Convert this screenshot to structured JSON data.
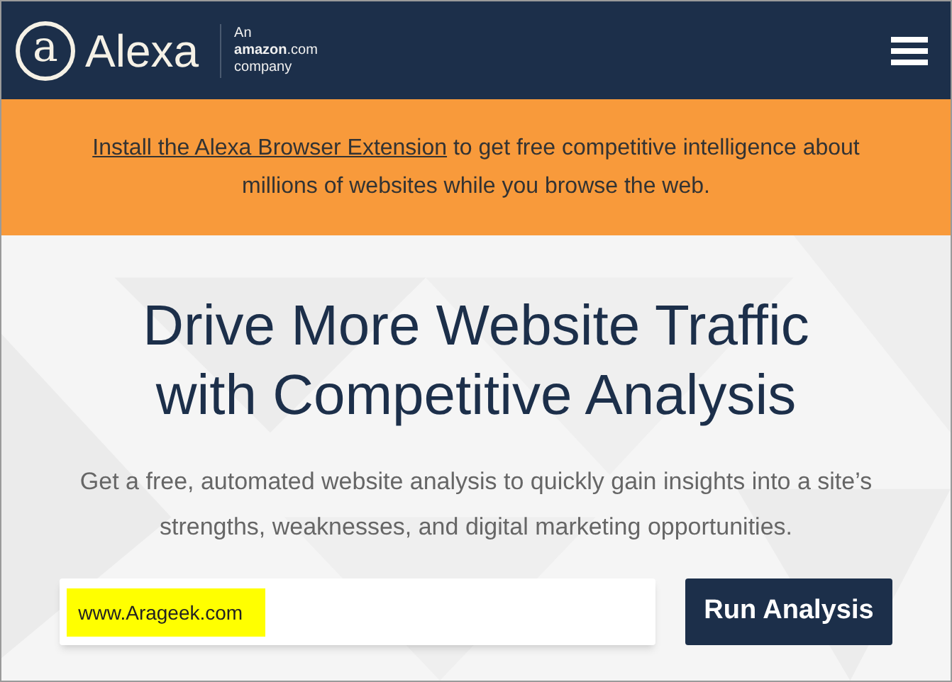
{
  "header": {
    "logo_mark": "a",
    "logo_name": "Alexa",
    "tagline": [
      "An",
      "**amazon**.com",
      "company"
    ]
  },
  "banner": {
    "link": "Install the Alexa Browser Extension",
    "text": " to get free competitive intelligence about millions of websites while you browse the web."
  },
  "hero": {
    "title": "Drive More Website Traffic with Competitive Analysis",
    "subtitle": "Get a free, automated website analysis to quickly gain insights into a site’s strengths, weaknesses, and digital marketing opportunities."
  },
  "search": {
    "value": "www.Arageek.com",
    "highlighted": true,
    "button": "Run Analysis"
  }
}
